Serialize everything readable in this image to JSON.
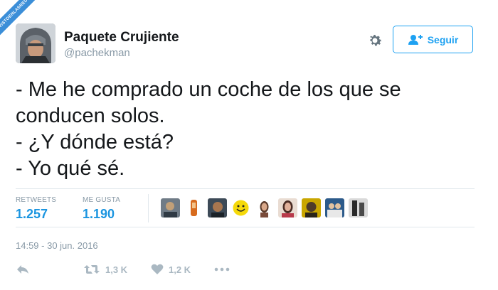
{
  "watermark": {
    "text": "VISTOENLASREDES"
  },
  "user": {
    "name": "Paquete Crujiente",
    "handle": "@pachekman"
  },
  "follow_button": {
    "label": "Seguir"
  },
  "tweet": {
    "lines": [
      "- Me he comprado un coche de los que se",
      "conducen solos.",
      "- ¿Y dónde está?",
      "- Yo qué sé."
    ]
  },
  "stats": {
    "retweets_label": "RETWEETS",
    "retweets_value": "1.257",
    "likes_label": "ME GUSTA",
    "likes_value": "1.190"
  },
  "likers_count": 9,
  "timestamp": "14:59 - 30 jun. 2016",
  "actions": {
    "retweet_count": "1,3 K",
    "like_count": "1,2 K"
  },
  "colors": {
    "accent": "#1da1f2",
    "stat_value": "#1b95e0",
    "muted": "#8899a6",
    "icon_muted": "#aab8c2"
  },
  "icons": [
    "gear-icon",
    "add-user-icon",
    "reply-icon",
    "retweet-icon",
    "heart-icon",
    "more-icon"
  ]
}
